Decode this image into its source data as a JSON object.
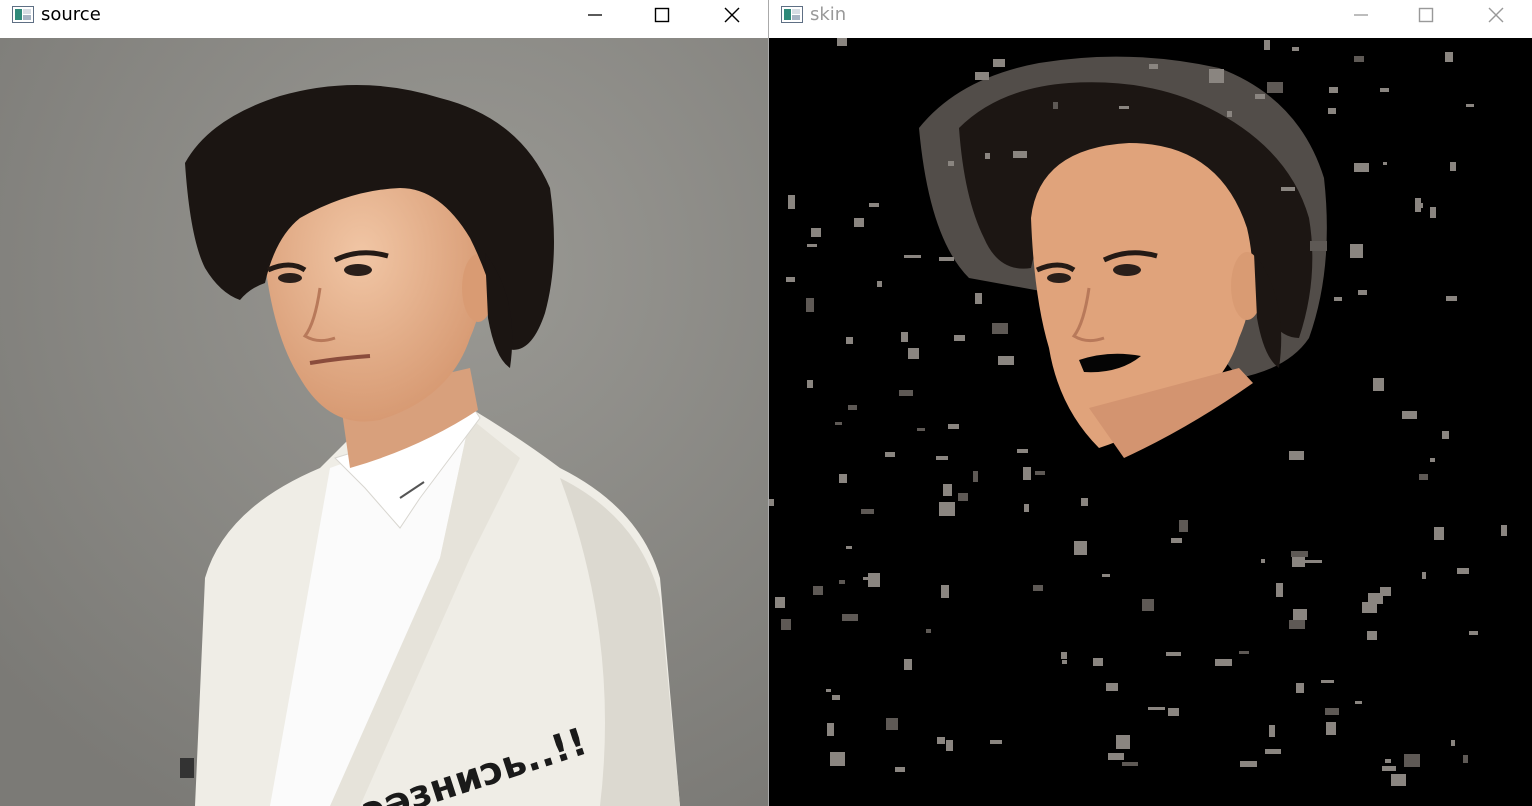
{
  "windows": [
    {
      "title": "source",
      "active": true,
      "icon": "app-image-icon",
      "controls": [
        "minimize-icon",
        "maximize-icon",
        "close-icon"
      ]
    },
    {
      "title": "skin",
      "active": false,
      "icon": "app-image-icon",
      "controls": [
        "minimize-icon",
        "maximize-icon",
        "close-icon"
      ]
    }
  ],
  "source_image": {
    "jacket_text": "ɐɔǝзниɔь..!!"
  },
  "colors": {
    "source_background": "#8b8a86",
    "skin_background": "#000000",
    "skin_tone": "#e0a37b",
    "hair": "#1b1512",
    "jacket": "#f1efe8",
    "shirt": "#fbfbfb",
    "noise": "#8a8580"
  }
}
